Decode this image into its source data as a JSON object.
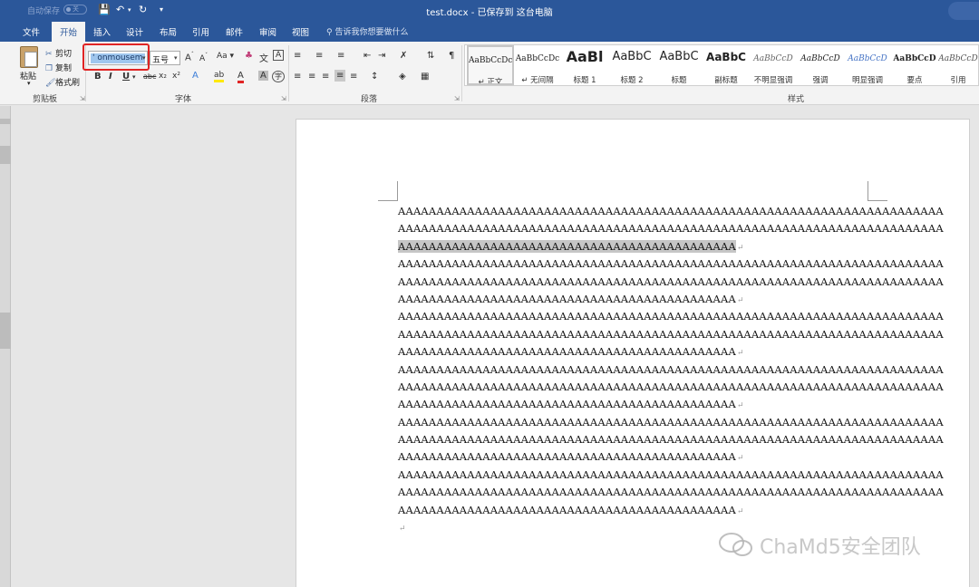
{
  "titlebar": {
    "autosave": "自动保存",
    "autosave_state": "关",
    "document_title": "test.docx - 已保存到 这台电脑"
  },
  "tabs": [
    {
      "label": "文件"
    },
    {
      "label": "开始",
      "active": true
    },
    {
      "label": "插入"
    },
    {
      "label": "设计"
    },
    {
      "label": "布局"
    },
    {
      "label": "引用"
    },
    {
      "label": "邮件"
    },
    {
      "label": "审阅"
    },
    {
      "label": "视图"
    }
  ],
  "tellme": "告诉我你想要做什么",
  "clipboard": {
    "paste": "粘贴",
    "cut": "剪切",
    "copy": "复制",
    "format_painter": "格式刷",
    "group_label": "剪贴板"
  },
  "font": {
    "font_name": "' onmousem",
    "font_size": "五号",
    "group_label": "字体",
    "bold": "B",
    "italic": "I",
    "underline": "U",
    "strike": "abc",
    "subscript": "x₂",
    "superscript": "x²",
    "grow": "A",
    "shrink": "A",
    "change_case": "Aa",
    "phonetic": "文"
  },
  "paragraph": {
    "group_label": "段落"
  },
  "styles": {
    "group_label": "样式",
    "items": [
      {
        "preview": "AaBbCcDc",
        "name": "↵ 正文",
        "selected": true
      },
      {
        "preview": "AaBbCcDc",
        "name": "↵ 无间隔"
      },
      {
        "preview": "AaBl",
        "name": "标题 1"
      },
      {
        "preview": "AaBbC",
        "name": "标题 2"
      },
      {
        "preview": "AaBbC",
        "name": "标题"
      },
      {
        "preview": "AaBbC",
        "name": "副标题"
      },
      {
        "preview": "AaBbCcD",
        "name": "不明显强调"
      },
      {
        "preview": "AaBbCcD",
        "name": "强调"
      },
      {
        "preview": "AaBbCcD",
        "name": "明显强调"
      },
      {
        "preview": "AaBbCcD",
        "name": "要点"
      },
      {
        "preview": "AaBbCcD",
        "name": "引用"
      }
    ]
  },
  "document": {
    "lines": [
      {
        "text": "AAAAAAAAAAAAAAAAAAAAAAAAAAAAAAAAAAAAAAAAAAAAAAAAAAAAAAAAAAAAAAAAAAAAAAA",
        "para": false,
        "selected": false
      },
      {
        "text": "AAAAAAAAAAAAAAAAAAAAAAAAAAAAAAAAAAAAAAAAAAAAAAAAAAAAAAAAAAAAAAAAAAAAAAA",
        "para": false,
        "selected": false
      },
      {
        "text": "AAAAAAAAAAAAAAAAAAAAAAAAAAAAAAAAAAAAAAAAAAAA",
        "para": true,
        "selected": true
      },
      {
        "text": "AAAAAAAAAAAAAAAAAAAAAAAAAAAAAAAAAAAAAAAAAAAAAAAAAAAAAAAAAAAAAAAAAAAAAAA",
        "para": false,
        "selected": false
      },
      {
        "text": "AAAAAAAAAAAAAAAAAAAAAAAAAAAAAAAAAAAAAAAAAAAAAAAAAAAAAAAAAAAAAAAAAAAAAAA",
        "para": false,
        "selected": false
      },
      {
        "text": "AAAAAAAAAAAAAAAAAAAAAAAAAAAAAAAAAAAAAAAAAAAA",
        "para": true,
        "selected": false
      },
      {
        "text": "AAAAAAAAAAAAAAAAAAAAAAAAAAAAAAAAAAAAAAAAAAAAAAAAAAAAAAAAAAAAAAAAAAAAAAA",
        "para": false,
        "selected": false
      },
      {
        "text": "AAAAAAAAAAAAAAAAAAAAAAAAAAAAAAAAAAAAAAAAAAAAAAAAAAAAAAAAAAAAAAAAAAAAAAA",
        "para": false,
        "selected": false
      },
      {
        "text": "AAAAAAAAAAAAAAAAAAAAAAAAAAAAAAAAAAAAAAAAAAAA",
        "para": true,
        "selected": false
      },
      {
        "text": "AAAAAAAAAAAAAAAAAAAAAAAAAAAAAAAAAAAAAAAAAAAAAAAAAAAAAAAAAAAAAAAAAAAAAAA",
        "para": false,
        "selected": false
      },
      {
        "text": "AAAAAAAAAAAAAAAAAAAAAAAAAAAAAAAAAAAAAAAAAAAAAAAAAAAAAAAAAAAAAAAAAAAAAAA",
        "para": false,
        "selected": false
      },
      {
        "text": "AAAAAAAAAAAAAAAAAAAAAAAAAAAAAAAAAAAAAAAAAAAA",
        "para": true,
        "selected": false
      },
      {
        "text": "AAAAAAAAAAAAAAAAAAAAAAAAAAAAAAAAAAAAAAAAAAAAAAAAAAAAAAAAAAAAAAAAAAAAAAA",
        "para": false,
        "selected": false
      },
      {
        "text": "AAAAAAAAAAAAAAAAAAAAAAAAAAAAAAAAAAAAAAAAAAAAAAAAAAAAAAAAAAAAAAAAAAAAAAA",
        "para": false,
        "selected": false
      },
      {
        "text": "AAAAAAAAAAAAAAAAAAAAAAAAAAAAAAAAAAAAAAAAAAAA",
        "para": true,
        "selected": false
      },
      {
        "text": "AAAAAAAAAAAAAAAAAAAAAAAAAAAAAAAAAAAAAAAAAAAAAAAAAAAAAAAAAAAAAAAAAAAAAAA",
        "para": false,
        "selected": false
      },
      {
        "text": "AAAAAAAAAAAAAAAAAAAAAAAAAAAAAAAAAAAAAAAAAAAAAAAAAAAAAAAAAAAAAAAAAAAAAAA",
        "para": false,
        "selected": false
      },
      {
        "text": "AAAAAAAAAAAAAAAAAAAAAAAAAAAAAAAAAAAAAAAAAAAA",
        "para": true,
        "selected": false
      },
      {
        "text": "",
        "para": true,
        "selected": false
      }
    ],
    "paragraph_mark": "↵"
  },
  "watermark": {
    "text": "ChaMd5安全团队"
  },
  "colors": {
    "titlebar": "#2b579a",
    "ribbon": "#f3f3f3",
    "highlight_outline": "#e02424",
    "font_name_selection": "#9fc6ee"
  }
}
